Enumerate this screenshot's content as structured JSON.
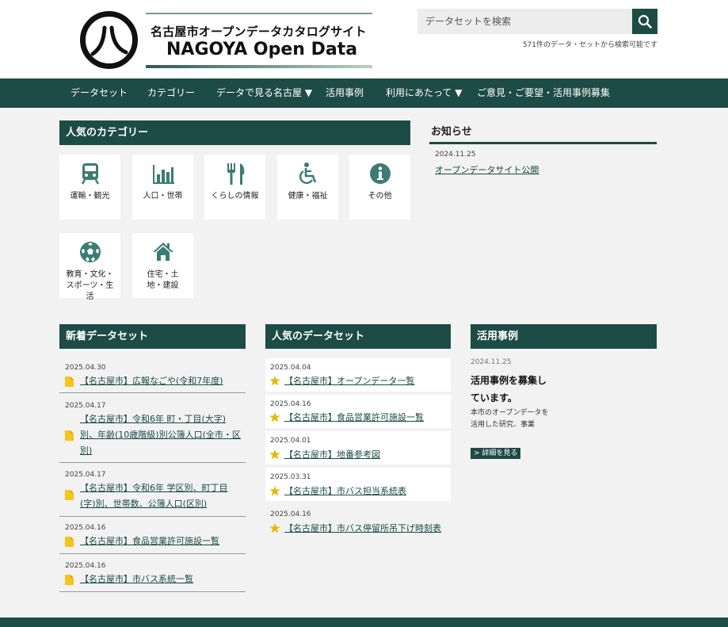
{
  "header": {
    "logo_ja": "名古屋市オープンデータカタログサイト",
    "logo_en": "NAGOYA Open Data",
    "search_placeholder": "データセットを検索",
    "search_note": "571件のデータ・セットから検索可能です"
  },
  "nav": {
    "items": [
      {
        "label": "データセット"
      },
      {
        "label": "カテゴリー"
      },
      {
        "label": "データで見る名古屋 ▼"
      },
      {
        "label": "活用事例"
      },
      {
        "label": "利用にあたって ▼"
      },
      {
        "label": "ご意見・ご要望・活用事例募集"
      }
    ]
  },
  "categories": {
    "heading": "人気のカテゴリー",
    "items": [
      {
        "label": "運輸・観光",
        "icon": "train-icon"
      },
      {
        "label": "人口・世帯",
        "icon": "bar-chart-icon"
      },
      {
        "label": "くらしの情報",
        "icon": "utensils-icon"
      },
      {
        "label": "健康・福祉",
        "icon": "wheelchair-icon"
      },
      {
        "label": "その他",
        "icon": "info-icon"
      },
      {
        "label": "教育・文化・スポーツ・生活",
        "icon": "soccer-ball-icon"
      },
      {
        "label": "住宅・土地・建設",
        "icon": "house-icon"
      }
    ]
  },
  "news": {
    "heading": "お知らせ",
    "items": [
      {
        "date": "2024.11.25",
        "title": "オープンデータサイト公開"
      }
    ]
  },
  "new_datasets": {
    "heading": "新着データセット",
    "items": [
      {
        "date": "2025.04.30",
        "title": "【名古屋市】広報なごや(令和7年度)"
      },
      {
        "date": "2025.04.17",
        "title": "【名古屋市】令和6年 町・丁目(大字)別、年齢(10歳階級)別公簿人口(全市・区別)"
      },
      {
        "date": "2025.04.17",
        "title": "【名古屋市】令和6年 学区別、町丁目(字)別、世帯数、公簿人口(区別)"
      },
      {
        "date": "2025.04.16",
        "title": "【名古屋市】食品営業許可施設一覧"
      },
      {
        "date": "2025.04.16",
        "title": "【名古屋市】市バス系統一覧"
      }
    ]
  },
  "popular_datasets": {
    "heading": "人気のデータセット",
    "items": [
      {
        "date": "2025.04.04",
        "title": "【名古屋市】オープンデータ一覧"
      },
      {
        "date": "2025.04.16",
        "title": "【名古屋市】食品営業許可施設一覧"
      },
      {
        "date": "2025.04.01",
        "title": "【名古屋市】地番参考図"
      },
      {
        "date": "2025.03.31",
        "title": "【名古屋市】市バス担当系統表"
      },
      {
        "date": "2025.04.16",
        "title": "【名古屋市】市バス停留所吊下げ時刻表"
      }
    ]
  },
  "cases": {
    "heading": "活用事例",
    "date": "2024.11.25",
    "title": "活用事例を募集しています。",
    "body": "本市のオープンデータを活用した研究、事業",
    "button": "> 詳細を見る"
  },
  "colors": {
    "brand": "#1d4b45",
    "file_icon": "#f5c518",
    "star_icon": "#e8b800"
  }
}
